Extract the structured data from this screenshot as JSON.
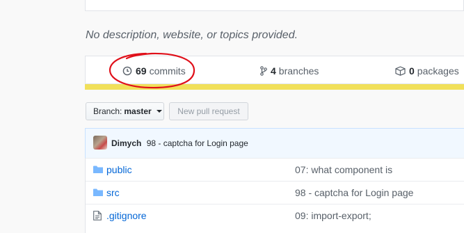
{
  "description": "No description, website, or topics provided.",
  "stats": {
    "commits": {
      "count": "69",
      "label": "commits",
      "icon": "history-icon"
    },
    "branches": {
      "count": "4",
      "label": "branches",
      "icon": "branch-icon"
    },
    "packages": {
      "count": "0",
      "label": "packages",
      "icon": "package-icon"
    }
  },
  "language_bar_color": "#f1e05a",
  "annotation_color": "#e0101a",
  "toolbar": {
    "branch_prefix": "Branch:",
    "branch_name": "master",
    "new_pr_label": "New pull request"
  },
  "latest_commit": {
    "author": "Dimych",
    "message": "98 - captcha for Login page"
  },
  "files": [
    {
      "type": "folder",
      "name": "public",
      "message": "07: what component is"
    },
    {
      "type": "folder",
      "name": "src",
      "message": "98 - captcha for Login page"
    },
    {
      "type": "file",
      "name": ".gitignore",
      "message": "09: import-export;"
    }
  ]
}
